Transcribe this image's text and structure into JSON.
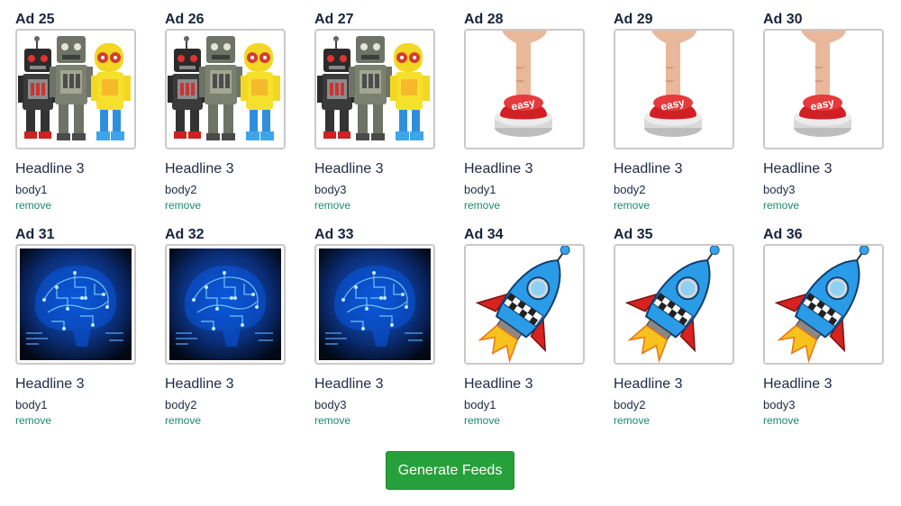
{
  "ads": [
    {
      "title": "Ad 25",
      "image": "robots-image",
      "headline": "Headline 3",
      "body": "body1",
      "remove": "remove"
    },
    {
      "title": "Ad 26",
      "image": "robots-image",
      "headline": "Headline 3",
      "body": "body2",
      "remove": "remove"
    },
    {
      "title": "Ad 27",
      "image": "robots-image",
      "headline": "Headline 3",
      "body": "body3",
      "remove": "remove"
    },
    {
      "title": "Ad 28",
      "image": "easy-button-image",
      "headline": "Headline 3",
      "body": "body1",
      "remove": "remove"
    },
    {
      "title": "Ad 29",
      "image": "easy-button-image",
      "headline": "Headline 3",
      "body": "body2",
      "remove": "remove"
    },
    {
      "title": "Ad 30",
      "image": "easy-button-image",
      "headline": "Headline 3",
      "body": "body3",
      "remove": "remove"
    },
    {
      "title": "Ad 31",
      "image": "circuit-brain-image",
      "headline": "Headline 3",
      "body": "body1",
      "remove": "remove"
    },
    {
      "title": "Ad 32",
      "image": "circuit-brain-image",
      "headline": "Headline 3",
      "body": "body2",
      "remove": "remove"
    },
    {
      "title": "Ad 33",
      "image": "circuit-brain-image",
      "headline": "Headline 3",
      "body": "body3",
      "remove": "remove"
    },
    {
      "title": "Ad 34",
      "image": "rocket-image",
      "headline": "Headline 3",
      "body": "body1",
      "remove": "remove"
    },
    {
      "title": "Ad 35",
      "image": "rocket-image",
      "headline": "Headline 3",
      "body": "body2",
      "remove": "remove"
    },
    {
      "title": "Ad 36",
      "image": "rocket-image",
      "headline": "Headline 3",
      "body": "body3",
      "remove": "remove"
    }
  ],
  "easy_label": "easy",
  "generate_button": "Generate Feeds",
  "colors": {
    "accent_button": "#25a03a",
    "remove_link": "#1a8a6e",
    "heading": "#16243d"
  }
}
